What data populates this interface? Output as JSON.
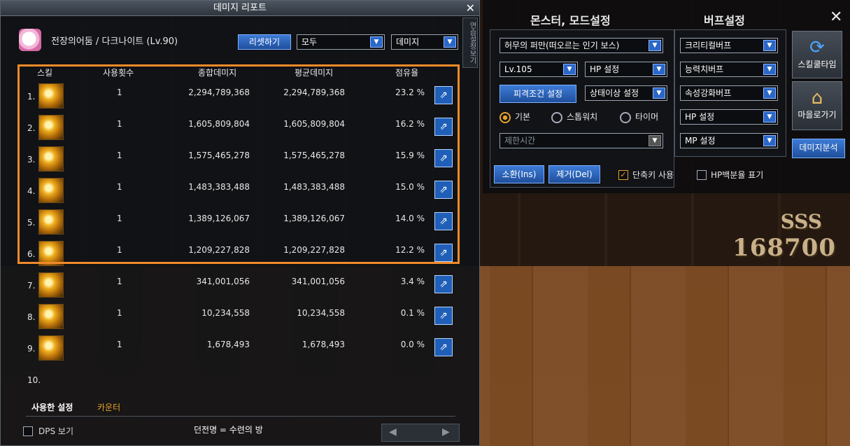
{
  "report": {
    "title": "데미지 리포트",
    "character": "전장의어둠 / 다크나이트 (Lv.90)",
    "reset_label": "리셋하기",
    "filter_select": "모두",
    "metric_select": "데미지",
    "side_tab": "연습설정보기",
    "columns": {
      "skill": "스킬",
      "uses": "사용횟수",
      "total": "종합데미지",
      "avg": "평균데미지",
      "share": "점유율"
    },
    "rows": [
      {
        "idx": "1.",
        "uses": "1",
        "total": "2,294,789,368",
        "avg": "2,294,789,368",
        "share": "23.2 %"
      },
      {
        "idx": "2.",
        "uses": "1",
        "total": "1,605,809,804",
        "avg": "1,605,809,804",
        "share": "16.2 %"
      },
      {
        "idx": "3.",
        "uses": "1",
        "total": "1,575,465,278",
        "avg": "1,575,465,278",
        "share": "15.9 %"
      },
      {
        "idx": "4.",
        "uses": "1",
        "total": "1,483,383,488",
        "avg": "1,483,383,488",
        "share": "15.0 %"
      },
      {
        "idx": "5.",
        "uses": "1",
        "total": "1,389,126,067",
        "avg": "1,389,126,067",
        "share": "14.0 %"
      },
      {
        "idx": "6.",
        "uses": "1",
        "total": "1,209,227,828",
        "avg": "1,209,227,828",
        "share": "12.2 %"
      },
      {
        "idx": "7.",
        "uses": "1",
        "total": "341,001,056",
        "avg": "341,001,056",
        "share": "3.4 %"
      },
      {
        "idx": "8.",
        "uses": "1",
        "total": "10,234,558",
        "avg": "10,234,558",
        "share": "0.1 %"
      },
      {
        "idx": "9.",
        "uses": "1",
        "total": "1,678,493",
        "avg": "1,678,493",
        "share": "0.0 %"
      },
      {
        "idx": "10.",
        "uses": "",
        "total": "",
        "avg": "",
        "share": ""
      }
    ],
    "tabs": {
      "used_settings": "사용한 설정",
      "counter": "카운터"
    },
    "dps_label": "DPS 보기",
    "dungeon": "던전명 = 수련의 방"
  },
  "settings": {
    "monster_title": "몬스터, 모드설정",
    "buff_title": "버프설정",
    "monster_select": "허무의 퍼만(떠오르는 인기 보스)",
    "level_select": "Lv.105",
    "hp_select": "HP 설정",
    "hit_condition_btn": "피격조건 설정",
    "status_select": "상태이상 설정",
    "radio_basic": "기본",
    "radio_stopwatch": "스톱워치",
    "radio_timer": "타이머",
    "time_limit_placeholder": "제한시간",
    "summon_btn": "소환(Ins)",
    "remove_btn": "제거(Del)",
    "shortcut_label": "단축키 사용",
    "hp_percent_label": "HP백분율 표기",
    "buffs": [
      "크리티컬버프",
      "능력치버프",
      "속성강화버프",
      "HP 설정",
      "MP 설정"
    ],
    "skill_cooldown_btn": "스킬쿨타임",
    "go_town_btn": "마을로가기",
    "damage_analysis_btn": "데미지분석"
  },
  "game": {
    "rank": "SSS",
    "score": "168700"
  }
}
